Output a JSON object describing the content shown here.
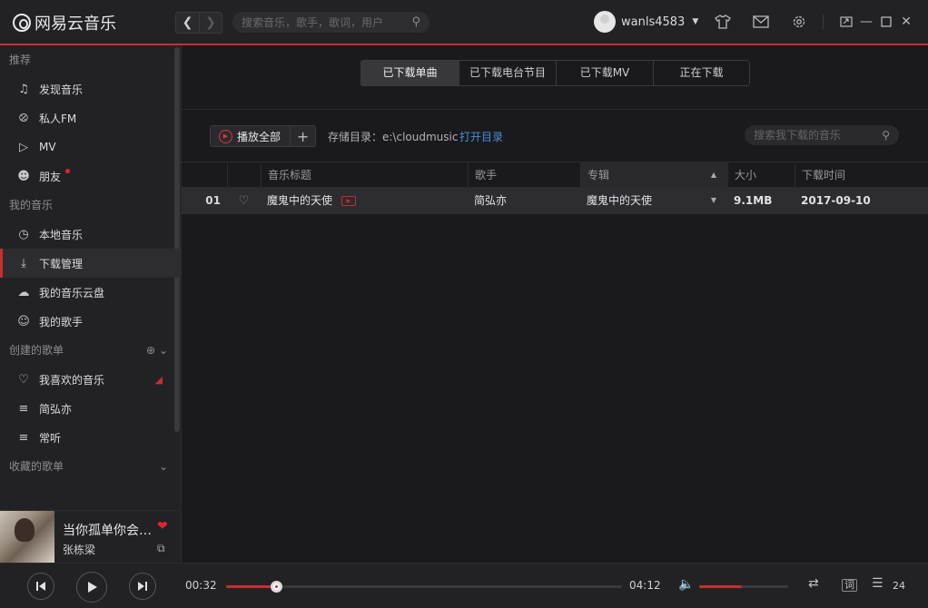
{
  "app": {
    "logo_text": "网易云音乐"
  },
  "topbar": {
    "search_placeholder": "搜索音乐，歌手，歌词，用户",
    "username": "wanls4583"
  },
  "sidebar": {
    "section_recommend": "推荐",
    "recommend_items": [
      {
        "label": "发现音乐",
        "icon": "music-note-icon"
      },
      {
        "label": "私人FM",
        "icon": "radio-icon"
      },
      {
        "label": "MV",
        "icon": "video-icon"
      },
      {
        "label": "朋友",
        "icon": "friends-icon"
      }
    ],
    "section_my_music": "我的音乐",
    "my_music_items": [
      {
        "label": "本地音乐",
        "icon": "local-music-icon"
      },
      {
        "label": "下载管理",
        "icon": "download-icon"
      },
      {
        "label": "我的音乐云盘",
        "icon": "cloud-icon"
      },
      {
        "label": "我的歌手",
        "icon": "singer-icon"
      }
    ],
    "section_created": "创建的歌单",
    "created_items": [
      {
        "label": "我喜欢的音乐",
        "icon": "heart-icon"
      },
      {
        "label": "简弘亦",
        "icon": "playlist-icon"
      },
      {
        "label": "常听",
        "icon": "playlist-icon"
      }
    ],
    "section_collected": "收藏的歌单"
  },
  "now_playing": {
    "title": "当你孤单你会想起谁",
    "artist": "张栋梁"
  },
  "main": {
    "tabs": [
      "已下载单曲",
      "已下载电台节目",
      "已下载MV",
      "正在下载"
    ],
    "active_tab": 0,
    "play_all_label": "播放全部",
    "storage_label": "存储目录：e:\\cloudmusic",
    "open_dir_label": "打开目录",
    "local_search_placeholder": "搜索我下载的音乐",
    "columns": [
      "音乐标题",
      "歌手",
      "专辑",
      "大小",
      "下载时间"
    ],
    "rows": [
      {
        "index": "01",
        "title": "魔鬼中的天使",
        "artist": "简弘亦",
        "album": "魔鬼中的天使",
        "size": "9.1MB",
        "date": "2017-09-10"
      }
    ]
  },
  "player": {
    "current_time": "00:32",
    "total_time": "04:12",
    "progress": 0.127,
    "volume": 0.48,
    "lyrics_label": "词",
    "playlist_count": "24"
  },
  "colors": {
    "accent": "#c62f2f",
    "link": "#4a8fd3",
    "background": "#1a1a1e",
    "sidebar": "#222225"
  }
}
